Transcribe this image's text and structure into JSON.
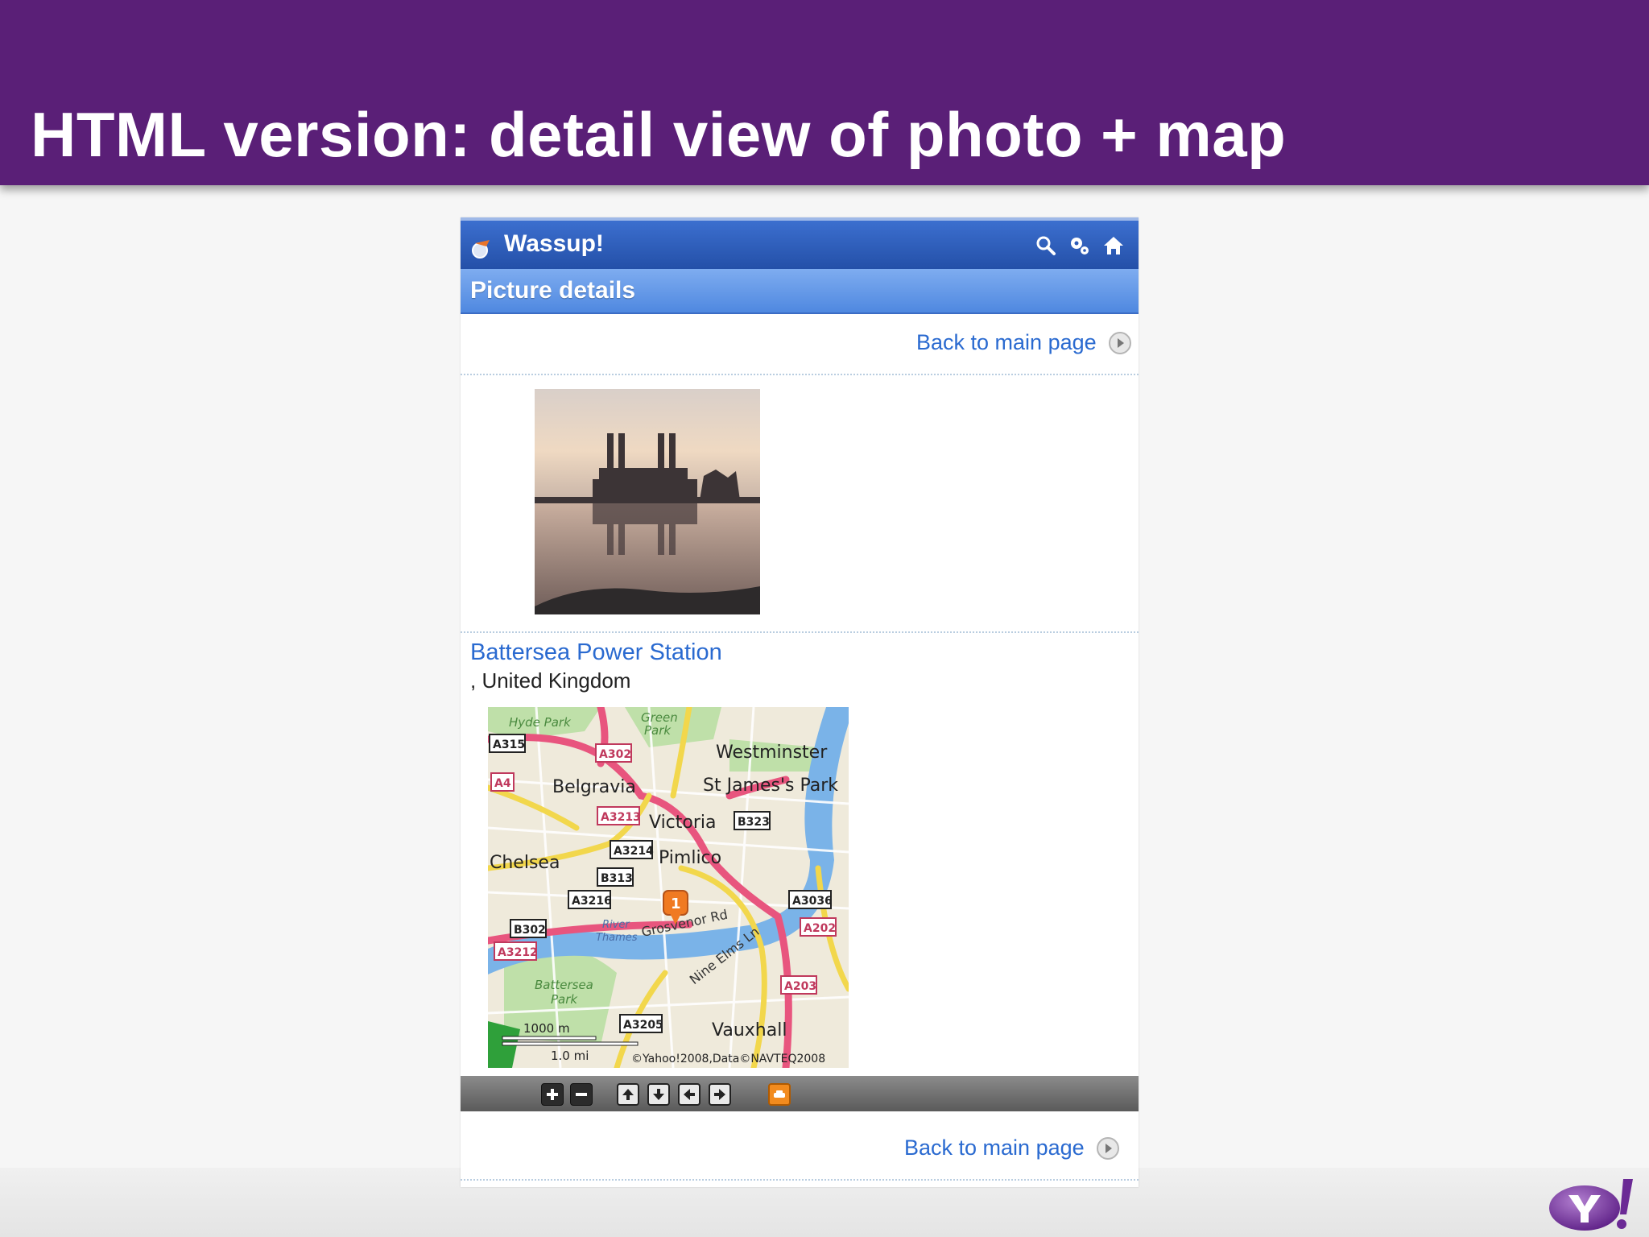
{
  "slide": {
    "title": "HTML version: detail view of photo + map"
  },
  "app": {
    "name": "Wassup!",
    "header_icons": [
      "search-icon",
      "settings-icon",
      "home-icon"
    ],
    "subheader": "Picture details",
    "back_link_top": "Back to main page",
    "back_link_bottom": "Back to main page"
  },
  "photo": {
    "subject": "Battersea Power Station photo"
  },
  "location": {
    "name": "Battersea Power Station",
    "country": ", United Kingdom"
  },
  "map": {
    "marker_label": "1",
    "places": [
      "Hyde Park",
      "Green Park",
      "Westminster",
      "Belgravia",
      "St James's Park",
      "Victoria",
      "Pimlico",
      "Chelsea",
      "Battersea Park",
      "Vauxhall",
      "River Thames"
    ],
    "roads": [
      "A315",
      "A302",
      "A4",
      "A3213",
      "B323",
      "A3214",
      "B313",
      "A3216",
      "A3036",
      "B302",
      "A202",
      "A3212",
      "A203",
      "A3205"
    ],
    "street_labels": [
      "Grosvenor Rd",
      "Nine Elms Ln"
    ],
    "scale_metric": "1000 m",
    "scale_imperial": "1.0 mi",
    "copyright": "©Yahoo!2008,Data©NAVTEQ2008"
  },
  "toolbar": {
    "buttons": [
      "zoom-in",
      "zoom-out",
      "pan-up",
      "pan-down",
      "pan-left",
      "pan-right",
      "traffic"
    ]
  },
  "colors": {
    "slide_header": "#5a1f77",
    "app_bar": "#2450a8",
    "subheader": "#4f88e0",
    "link": "#2a6ad0"
  }
}
